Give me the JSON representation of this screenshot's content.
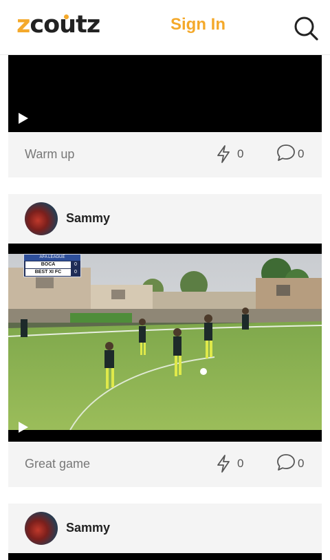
{
  "header": {
    "logo": "zcoutz",
    "signin_label": "Sign In",
    "search_icon": "search-icon"
  },
  "posts": [
    {
      "caption": "Warm up",
      "boosts": "0",
      "comments": "0"
    },
    {
      "author": "Sammy",
      "scoreboard": {
        "league": "AFA LEAGUE",
        "team1": "BOCA",
        "team1_score": "0",
        "team2": "BEST XI FC",
        "team2_score": "0"
      },
      "caption": "Great game",
      "boosts": "0",
      "comments": "0"
    },
    {
      "author": "Sammy"
    }
  ],
  "colors": {
    "accent": "#f4a92b",
    "card": "#f4f4f4",
    "text": "#222222",
    "muted": "#777777"
  }
}
